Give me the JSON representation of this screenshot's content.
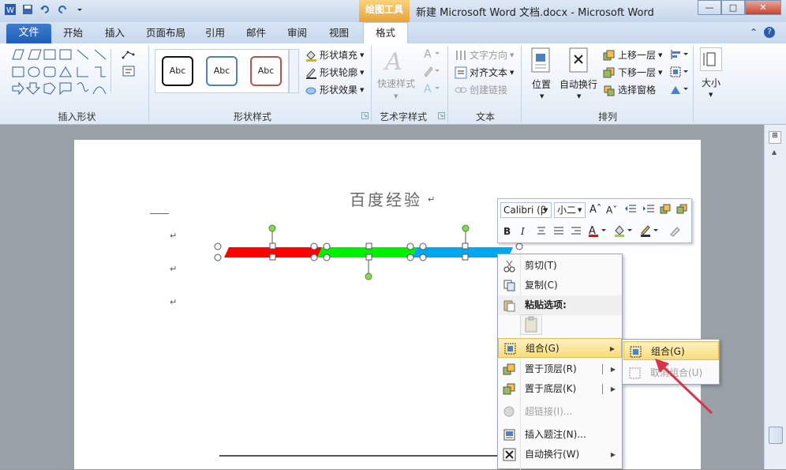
{
  "titlebar": {
    "context_tool": "绘图工具",
    "doc_title": "新建 Microsoft Word 文档.docx - Microsoft Word",
    "min": "—",
    "max": "□",
    "close": "✕"
  },
  "tabs": {
    "file": "文件",
    "items": [
      "开始",
      "插入",
      "页面布局",
      "引用",
      "邮件",
      "审阅",
      "视图"
    ],
    "format": "格式",
    "help": "?"
  },
  "ribbon": {
    "groups": {
      "insert_shapes": "插入形状",
      "shape_styles": "形状样式",
      "wordart_styles": "艺术字样式",
      "text": "文本",
      "arrange": "排列"
    },
    "shape_styles_gallery": [
      "Abc",
      "Abc",
      "Abc"
    ],
    "shape_fill": "形状填充",
    "shape_outline": "形状轮廓",
    "shape_effects": "形状效果",
    "quick_styles": "快速样式",
    "text_direction": "文字方向",
    "align_text": "对齐文本",
    "create_link": "创建链接",
    "position": "位置",
    "wrap_text": "自动换行",
    "bring_forward": "上移一层",
    "send_backward": "下移一层",
    "selection_pane": "选择窗格",
    "size": "大小"
  },
  "document": {
    "heading": "百度经验"
  },
  "mini_toolbar": {
    "font": "Calibri (β",
    "size": "小二"
  },
  "context_menu": {
    "items": [
      {
        "label": "剪切(T)",
        "disabled": false
      },
      {
        "label": "复制(C)",
        "disabled": false
      },
      {
        "label": "粘贴选项:",
        "disabled": false
      },
      {
        "label": "组合(G)",
        "disabled": false
      },
      {
        "label": "置于顶层(R)",
        "disabled": false
      },
      {
        "label": "置于底层(K)",
        "disabled": false
      },
      {
        "label": "超链接(I)...",
        "disabled": true
      },
      {
        "label": "插入题注(N)...",
        "disabled": false
      },
      {
        "label": "自动换行(W)",
        "disabled": false
      }
    ]
  },
  "submenu": {
    "items": [
      {
        "label": "组合(G)",
        "disabled": false
      },
      {
        "label": "取消组合(U)",
        "disabled": true
      }
    ]
  },
  "colors": {
    "red": "#ff0000",
    "green": "#00ee00",
    "blue": "#00a6ee",
    "arrow": "#d9344a"
  }
}
